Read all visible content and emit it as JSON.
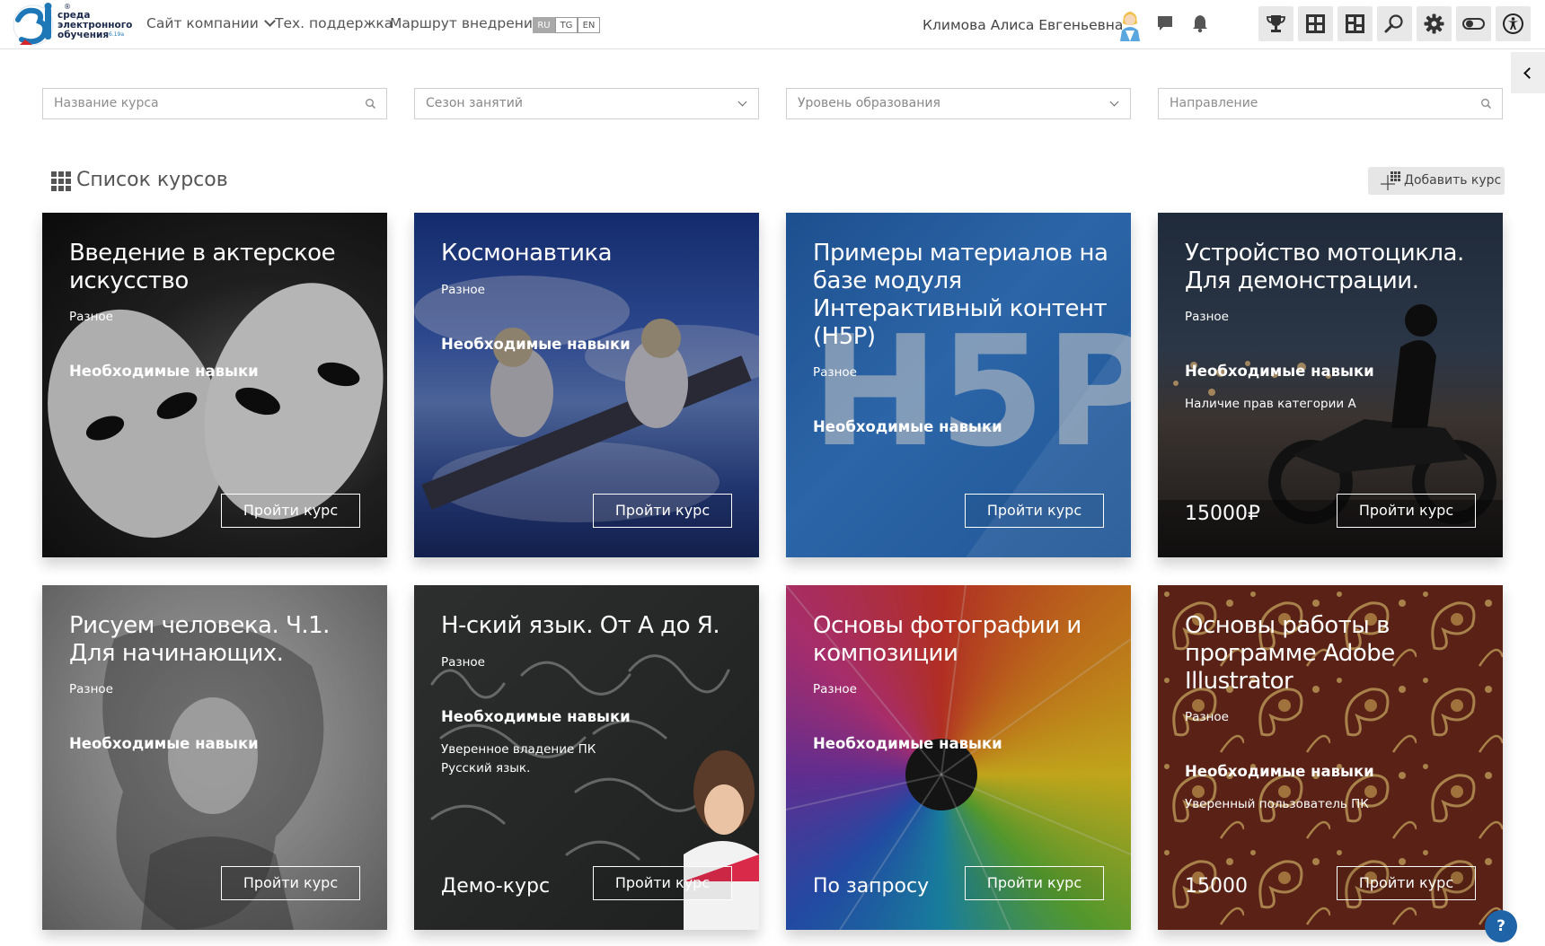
{
  "header": {
    "logo": {
      "mark": "3i",
      "line1": "среда",
      "line2": "электронного",
      "line3": "обучения",
      "version": "6.19а"
    },
    "nav": [
      {
        "label": "Сайт компании",
        "has_dropdown": true
      },
      {
        "label": "Тех. поддержка"
      },
      {
        "label": "Маршрут внедрения"
      }
    ],
    "languages": [
      {
        "code": "RU",
        "active": true
      },
      {
        "code": "TG",
        "active": false
      },
      {
        "code": "EN",
        "active": false
      }
    ],
    "user_name": "Климова Алиса Евгеньевна",
    "icons": [
      "chat-icon",
      "bell-icon"
    ],
    "tools": [
      "trophy-icon",
      "grid-layout-icon",
      "puzzle-board-icon",
      "search-icon",
      "gear-icon",
      "toggle-icon",
      "accessibility-icon"
    ]
  },
  "filters": {
    "course_name": {
      "placeholder": "Название курса"
    },
    "season": {
      "value": "Сезон занятий"
    },
    "education_level": {
      "value": "Уровень образования"
    },
    "direction": {
      "placeholder": "Направление"
    }
  },
  "section": {
    "title": "Список курсов",
    "add_button": "Добавить курс"
  },
  "courses": [
    {
      "title": "Введение в актерское искусство",
      "category": "Разное",
      "skills_label": "Необходимые навыки",
      "requirements": [],
      "price": "",
      "button": "Пройти курс"
    },
    {
      "title": "Космонавтика",
      "category": "Разное",
      "skills_label": "Необходимые навыки",
      "requirements": [],
      "price": "",
      "button": "Пройти курс"
    },
    {
      "title": "Примеры материалов на базе модуля Интерактивный контент (H5P)",
      "category": "Разное",
      "skills_label": "Необходимые навыки",
      "requirements": [],
      "price": "",
      "button": "Пройти курс"
    },
    {
      "title": "Устройство мотоцикла. Для демонстрации.",
      "category": "Разное",
      "skills_label": "Необходимые навыки",
      "requirements": [
        "Наличие прав категории А"
      ],
      "price": "15000₽",
      "button": "Пройти курс"
    },
    {
      "title": "Рисуем человека. Ч.1. Для начинающих.",
      "category": "Разное",
      "skills_label": "Необходимые навыки",
      "requirements": [],
      "price": "",
      "button": "Пройти курс"
    },
    {
      "title": "Н-ский язык. От А до Я.",
      "category": "Разное",
      "skills_label": "Необходимые навыки",
      "requirements": [
        "Уверенное владение ПК",
        "Русский язык."
      ],
      "price": "Демо-курс",
      "button": "Пройти курс"
    },
    {
      "title": "Основы фотографии и композиции",
      "category": "Разное",
      "skills_label": "Необходимые навыки",
      "requirements": [],
      "price": "По запросу",
      "button": "Пройти курс"
    },
    {
      "title": "Основы работы в программе Adobe Illustrator",
      "category": "Разное",
      "skills_label": "Необходимые навыки",
      "requirements": [
        "Уверенный пользователь ПК"
      ],
      "price": "15000",
      "button": "Пройти курс"
    }
  ],
  "help_button": "?"
}
